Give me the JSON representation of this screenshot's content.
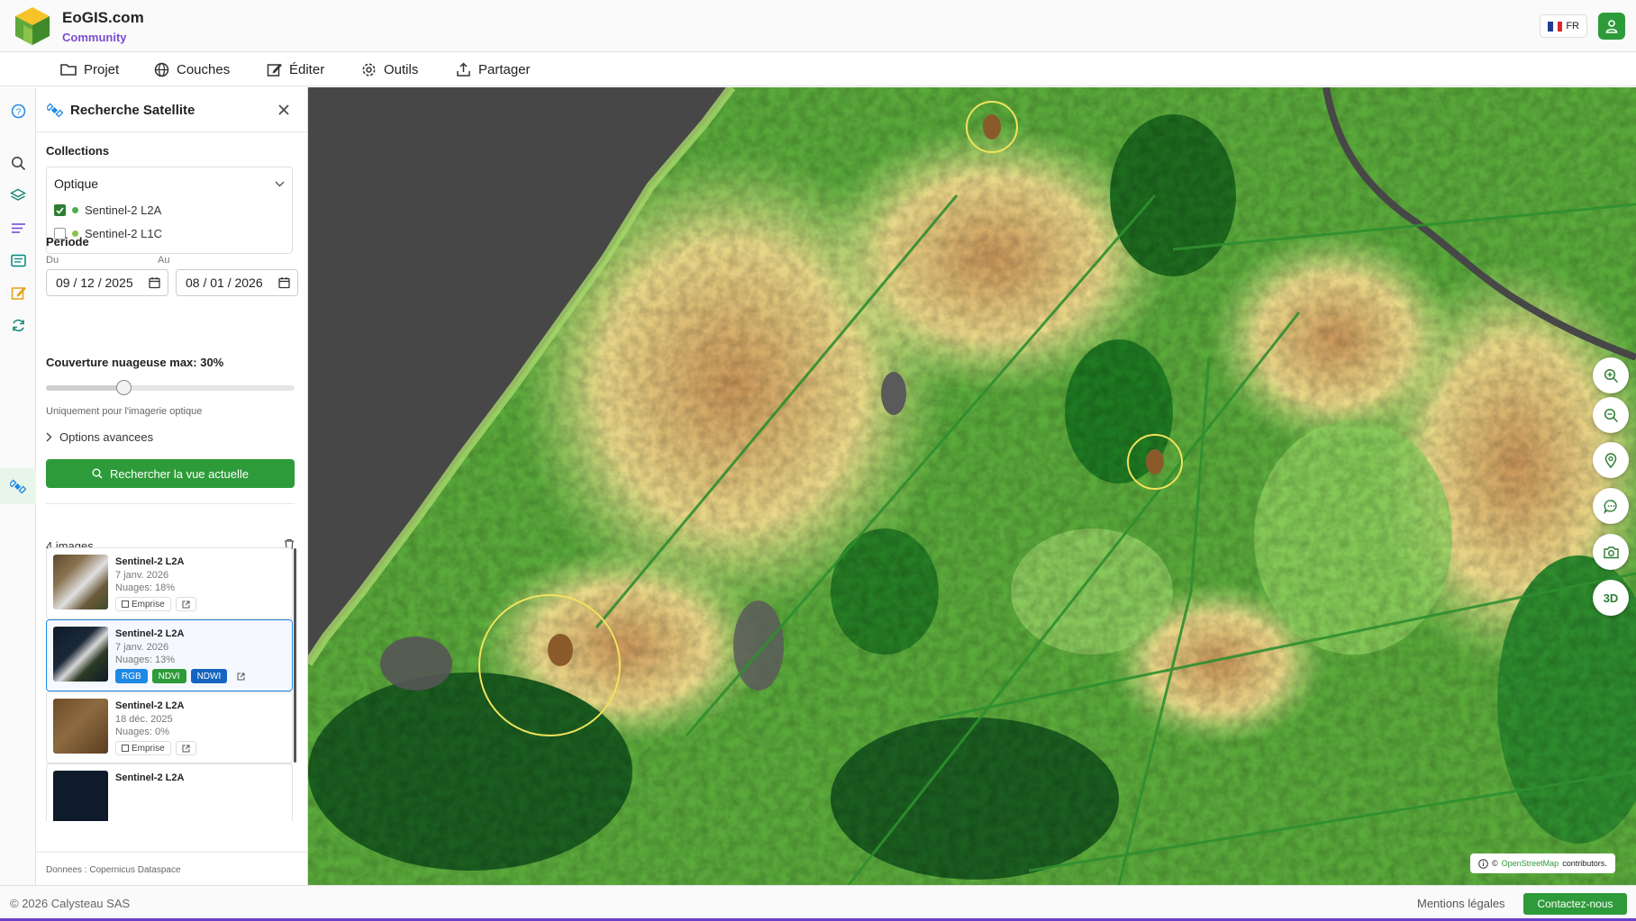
{
  "header": {
    "brand": "EoGIS.com",
    "brand_sub": "Community",
    "language": "FR"
  },
  "menu": {
    "items": [
      {
        "label": "Projet",
        "icon": "folder-icon"
      },
      {
        "label": "Couches",
        "icon": "globe-icon"
      },
      {
        "label": "Éditer",
        "icon": "edit-icon"
      },
      {
        "label": "Outils",
        "icon": "gear-icon"
      },
      {
        "label": "Partager",
        "icon": "share-icon"
      }
    ]
  },
  "rail": {
    "icons": [
      "help-icon",
      "search-icon",
      "layers-icon",
      "list-icon",
      "news-icon",
      "pencil-icon",
      "sync-icon",
      "satellite-icon"
    ],
    "active": "satellite-icon"
  },
  "panel": {
    "title": "Recherche Satellite",
    "collections_label": "Collections",
    "collection_select": "Optique",
    "collections": [
      {
        "label": "Sentinel-2 L2A",
        "checked": true
      },
      {
        "label": "Sentinel-2 L1C",
        "checked": false
      }
    ],
    "period_label": "Periode",
    "from_label": "Du",
    "to_label": "Au",
    "from_date": "09 / 12 / 2025",
    "to_date": "08 / 01 / 2026",
    "cloud_label": "Couverture nuageuse max: 30%",
    "cloud_max_percent": 30,
    "cloud_hint": "Uniquement pour l'imagerie optique",
    "advanced_label": "Options avancees",
    "search_button": "Rechercher la vue actuelle",
    "results_count": "4 images",
    "results": [
      {
        "title": "Sentinel-2 L2A",
        "date": "7 janv. 2026",
        "clouds": "Nuages: 18%",
        "actions": [
          "Emprise"
        ],
        "selected": false
      },
      {
        "title": "Sentinel-2 L2A",
        "date": "7 janv. 2026",
        "clouds": "Nuages: 13%",
        "actions": [
          "RGB",
          "NDVI",
          "NDWI"
        ],
        "selected": true
      },
      {
        "title": "Sentinel-2 L2A",
        "date": "18 déc. 2025",
        "clouds": "Nuages: 0%",
        "actions": [
          "Emprise"
        ],
        "selected": false
      },
      {
        "title": "Sentinel-2 L2A",
        "date": "",
        "clouds": "",
        "actions": [],
        "selected": false
      }
    ],
    "footer": "Donnees : Copernicus Dataspace"
  },
  "map": {
    "attribution_prefix": "©",
    "attribution_link": "OpenStreetMap",
    "attribution_suffix": "contributors.",
    "controls": [
      "zoom-in-icon",
      "zoom-out-icon",
      "location-pin-icon",
      "comment-icon",
      "camera-icon"
    ],
    "view_3d_label": "3D"
  },
  "footer": {
    "copyright": "© 2026 Calysteau SAS",
    "legal": "Mentions légales",
    "contact": "Contactez-nous"
  },
  "colors": {
    "brand_green": "#2e9b3a",
    "brand_purple": "#7b4bd1",
    "selected_blue": "#1e88e5"
  }
}
